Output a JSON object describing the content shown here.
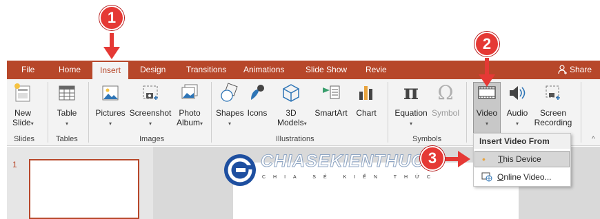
{
  "tabs": [
    "File",
    "Home",
    "Insert",
    "Design",
    "Transitions",
    "Animations",
    "Slide Show",
    "Revie"
  ],
  "share_label": "Share",
  "ribbon": {
    "new_slide": [
      "New",
      "Slide"
    ],
    "table": "Table",
    "pictures": "Pictures",
    "screenshot": "Screenshot",
    "photo_album": [
      "Photo",
      "Album"
    ],
    "shapes": "Shapes",
    "icons": "Icons",
    "models_3d": [
      "3D",
      "Models"
    ],
    "smartart": "SmartArt",
    "chart": "Chart",
    "equation": "Equation",
    "symbol": "Symbol",
    "video": "Video",
    "audio": "Audio",
    "screen_recording": [
      "Screen",
      "Recording"
    ]
  },
  "groups": [
    "Slides",
    "Tables",
    "Images",
    "Illustrations",
    "Symbols"
  ],
  "slide_pane": {
    "slide_number": "1"
  },
  "menu": {
    "header": "Insert Video From",
    "items": [
      {
        "pre": "",
        "ul": "T",
        "post": "his Device"
      },
      {
        "pre": "",
        "ul": "O",
        "post": "nline Video..."
      }
    ]
  },
  "watermark": {
    "title": "CHIASEKIENTHUC",
    "subtitle": "CHIA SẺ KIẾN THỨC"
  },
  "markers": [
    "1",
    "2",
    "3"
  ],
  "colors": {
    "accent": "#b7472a",
    "marker": "#e53935",
    "ribbon_bg": "#f3f3f3"
  }
}
